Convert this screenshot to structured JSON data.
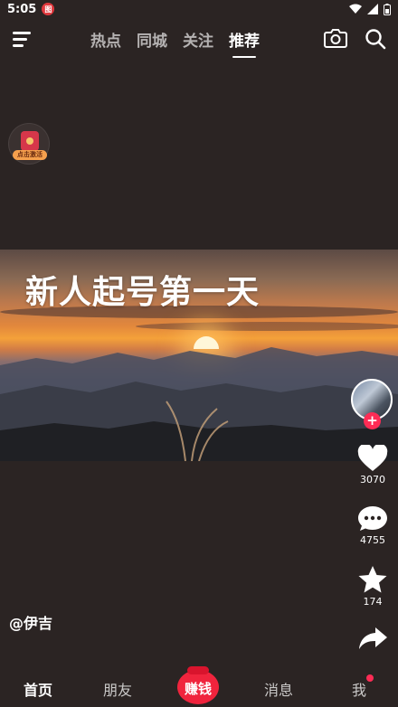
{
  "status_bar": {
    "time": "5:05",
    "app_badge": "图"
  },
  "top_nav": {
    "menu_icon": "menu-icon",
    "tabs": [
      "热点",
      "同城",
      "关注",
      "推荐"
    ],
    "active_tab": "推荐",
    "camera_icon": "camera-icon",
    "search_icon": "search-icon"
  },
  "activity": {
    "label": "点击激活"
  },
  "video": {
    "caption": "新人起号第一天"
  },
  "actions": {
    "like_count": "3070",
    "comment_count": "4755",
    "favorite_count": "174"
  },
  "author": {
    "name": "@伊吉"
  },
  "bottom_nav": {
    "home": "首页",
    "friends": "朋友",
    "earn": "赚钱",
    "messages": "消息",
    "me": "我"
  },
  "colors": {
    "accent": "#fe2c55",
    "earn": "#f0243d",
    "background": "#2b2423"
  }
}
